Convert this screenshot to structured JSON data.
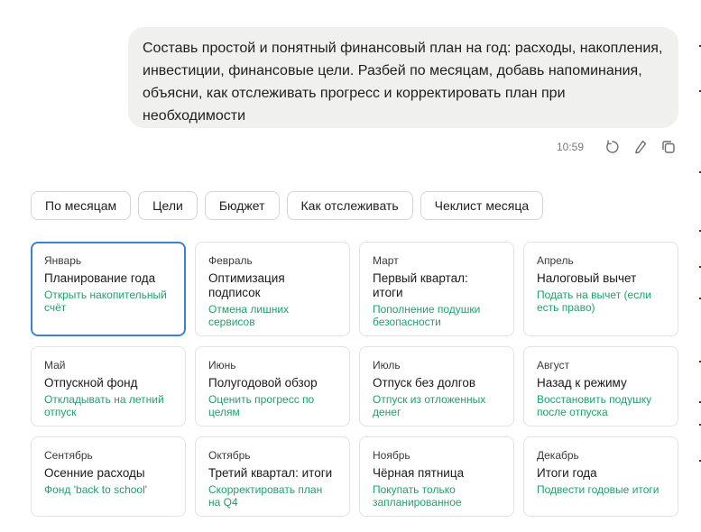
{
  "message": {
    "text": "Составь простой и понятный финансовый план на год: расходы, накопления, инвестиции, финансовые цели. Разбей по месяцам, добавь напоминания, объясни, как отслеживать прогресс и корректировать план при необходимости",
    "time": "10:59"
  },
  "icons": {
    "regenerate": "refresh-icon",
    "edit": "pencil-icon",
    "copy": "copy-icon"
  },
  "chips": [
    {
      "label": "По месяцам"
    },
    {
      "label": "Цели"
    },
    {
      "label": "Бюджет"
    },
    {
      "label": "Как отслеживать"
    },
    {
      "label": "Чеклист месяца"
    }
  ],
  "months": [
    {
      "month": "Январь",
      "title": "Планирование года",
      "action": "Открыть накопительный счёт",
      "selected": true
    },
    {
      "month": "Февраль",
      "title": "Оптимизация подписок",
      "action": "Отмена лишних сервисов"
    },
    {
      "month": "Март",
      "title": "Первый квартал: итоги",
      "action": "Пополнение подушки безопасности"
    },
    {
      "month": "Апрель",
      "title": "Налоговый вычет",
      "action": "Подать на вычет (если есть право)"
    },
    {
      "month": "Май",
      "title": "Отпускной фонд",
      "action": "Откладывать на летний отпуск"
    },
    {
      "month": "Июнь",
      "title": "Полугодовой обзор",
      "action": "Оценить прогресс по целям"
    },
    {
      "month": "Июль",
      "title": "Отпуск без долгов",
      "action": "Отпуск из отложенных денег"
    },
    {
      "month": "Август",
      "title": "Назад к режиму",
      "action": "Восстановить подушку после отпуска"
    },
    {
      "month": "Сентябрь",
      "title": "Осенние расходы",
      "action": "Фонд 'back to school'"
    },
    {
      "month": "Октябрь",
      "title": "Третий квартал: итоги",
      "action": "Скорректировать план на Q4"
    },
    {
      "month": "Ноябрь",
      "title": "Чёрная пятница",
      "action": "Покупать только запланированное"
    },
    {
      "month": "Декабрь",
      "title": "Итоги года",
      "action": "Подвести годовые итоги"
    }
  ],
  "colors": {
    "accent_green": "#22a06b",
    "selected_border": "#3b82d6",
    "bubble_bg": "#f0f0ef"
  }
}
